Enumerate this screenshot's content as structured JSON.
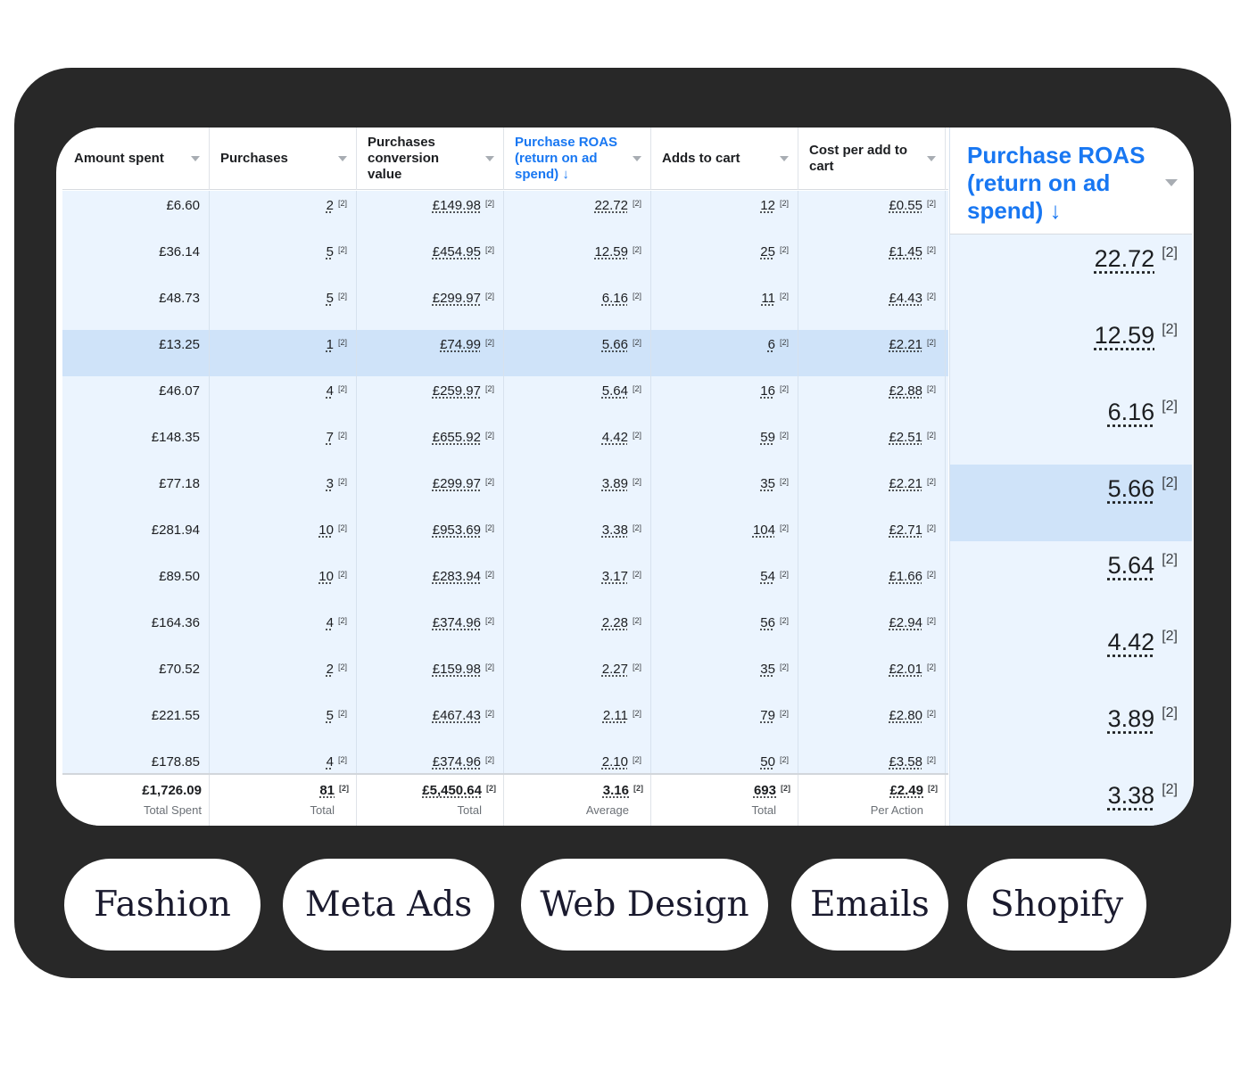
{
  "table": {
    "columns": [
      {
        "label": "Amount spent"
      },
      {
        "label": "Purchases"
      },
      {
        "label": "Purchases conversion value"
      },
      {
        "label": "Purchase ROAS (return on ad spend) ↓"
      },
      {
        "label": "Adds to cart"
      },
      {
        "label": "Cost per add to cart"
      }
    ],
    "sort_column": 3,
    "footnote_marker": "[2]",
    "highlighted_row": 3,
    "rows": [
      [
        "£6.60",
        "2",
        "£149.98",
        "22.72",
        "12",
        "£0.55"
      ],
      [
        "£36.14",
        "5",
        "£454.95",
        "12.59",
        "25",
        "£1.45"
      ],
      [
        "£48.73",
        "5",
        "£299.97",
        "6.16",
        "11",
        "£4.43"
      ],
      [
        "£13.25",
        "1",
        "£74.99",
        "5.66",
        "6",
        "£2.21"
      ],
      [
        "£46.07",
        "4",
        "£259.97",
        "5.64",
        "16",
        "£2.88"
      ],
      [
        "£148.35",
        "7",
        "£655.92",
        "4.42",
        "59",
        "£2.51"
      ],
      [
        "£77.18",
        "3",
        "£299.97",
        "3.89",
        "35",
        "£2.21"
      ],
      [
        "£281.94",
        "10",
        "£953.69",
        "3.38",
        "104",
        "£2.71"
      ],
      [
        "£89.50",
        "10",
        "£283.94",
        "3.17",
        "54",
        "£1.66"
      ],
      [
        "£164.36",
        "4",
        "£374.96",
        "2.28",
        "56",
        "£2.94"
      ],
      [
        "£70.52",
        "2",
        "£159.98",
        "2.27",
        "35",
        "£2.01"
      ],
      [
        "£221.55",
        "5",
        "£467.43",
        "2.11",
        "79",
        "£2.80"
      ],
      [
        "£178.85",
        "4",
        "£374.96",
        "2.10",
        "50",
        "£3.58"
      ]
    ],
    "totals": [
      {
        "value": "£1,726.09",
        "label": "Total Spent"
      },
      {
        "value": "81",
        "label": "Total"
      },
      {
        "value": "£5,450.64",
        "label": "Total"
      },
      {
        "value": "3.16",
        "label": "Average"
      },
      {
        "value": "693",
        "label": "Total"
      },
      {
        "value": "£2.49",
        "label": "Per Action"
      }
    ]
  },
  "zoom": {
    "header": "Purchase ROAS (return on ad spend) ↓",
    "values": [
      "22.72",
      "12.59",
      "6.16",
      "5.66",
      "5.64",
      "4.42",
      "3.89",
      "3.38"
    ],
    "highlighted_row": 3
  },
  "tags": [
    "Fashion",
    "Meta Ads",
    "Web Design",
    "Emails",
    "Shopify"
  ],
  "colors": {
    "accent_blue": "#1877f2",
    "row_background": "#ebf4fe",
    "row_highlight": "#cfe3f9",
    "frame_dark": "#282828"
  }
}
